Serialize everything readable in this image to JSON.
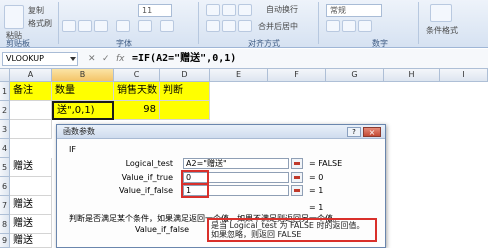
{
  "ribbon": {
    "paste_label": "粘贴",
    "copy_label": "复制",
    "format_painter_label": "格式刷",
    "clipboard_group": "剪贴板",
    "font_group": "字体",
    "font_size": "11",
    "alignment_group": "对齐方式",
    "merge_center_label": "合并后居中",
    "wrap_text_label": "自动换行",
    "number_group": "数字",
    "number_format": "常规",
    "conditional_format_label": "条件格式"
  },
  "formula_bar": {
    "name_box": "VLOOKUP",
    "formula": "=IF(A2=\"赠送\",0,1)"
  },
  "grid": {
    "columns": [
      "A",
      "B",
      "C",
      "D",
      "E",
      "F",
      "G",
      "H",
      "I"
    ],
    "rows": [
      "1",
      "2",
      "3",
      "4",
      "5",
      "6",
      "7",
      "8",
      "9"
    ],
    "header_row": [
      "备注",
      "数量",
      "销售天数",
      "判断"
    ],
    "row2": {
      "b": "送\",0,1)",
      "c": "98"
    },
    "col_a_values": [
      "赠送",
      "赠送",
      "赠送",
      "赠送"
    ]
  },
  "dialog": {
    "title": "函数参数",
    "function_name": "IF",
    "help": "?",
    "close": "×",
    "args": [
      {
        "label": "Logical_test",
        "value": "A2=\"赠送\"",
        "result": "= FALSE"
      },
      {
        "label": "Value_if_true",
        "value": "0",
        "result": "= 0"
      },
      {
        "label": "Value_if_false",
        "value": "1",
        "result": "= 1"
      }
    ],
    "formula_result": "= 1",
    "description": "判断是否满足某个条件，如果满足返回一个值，如果不满足则返回另一个值。",
    "param_label": "Value_if_false",
    "param_description": "是当 Logical_test 为 FALSE 时的返回值。如果忽略，则返回 FALSE"
  }
}
